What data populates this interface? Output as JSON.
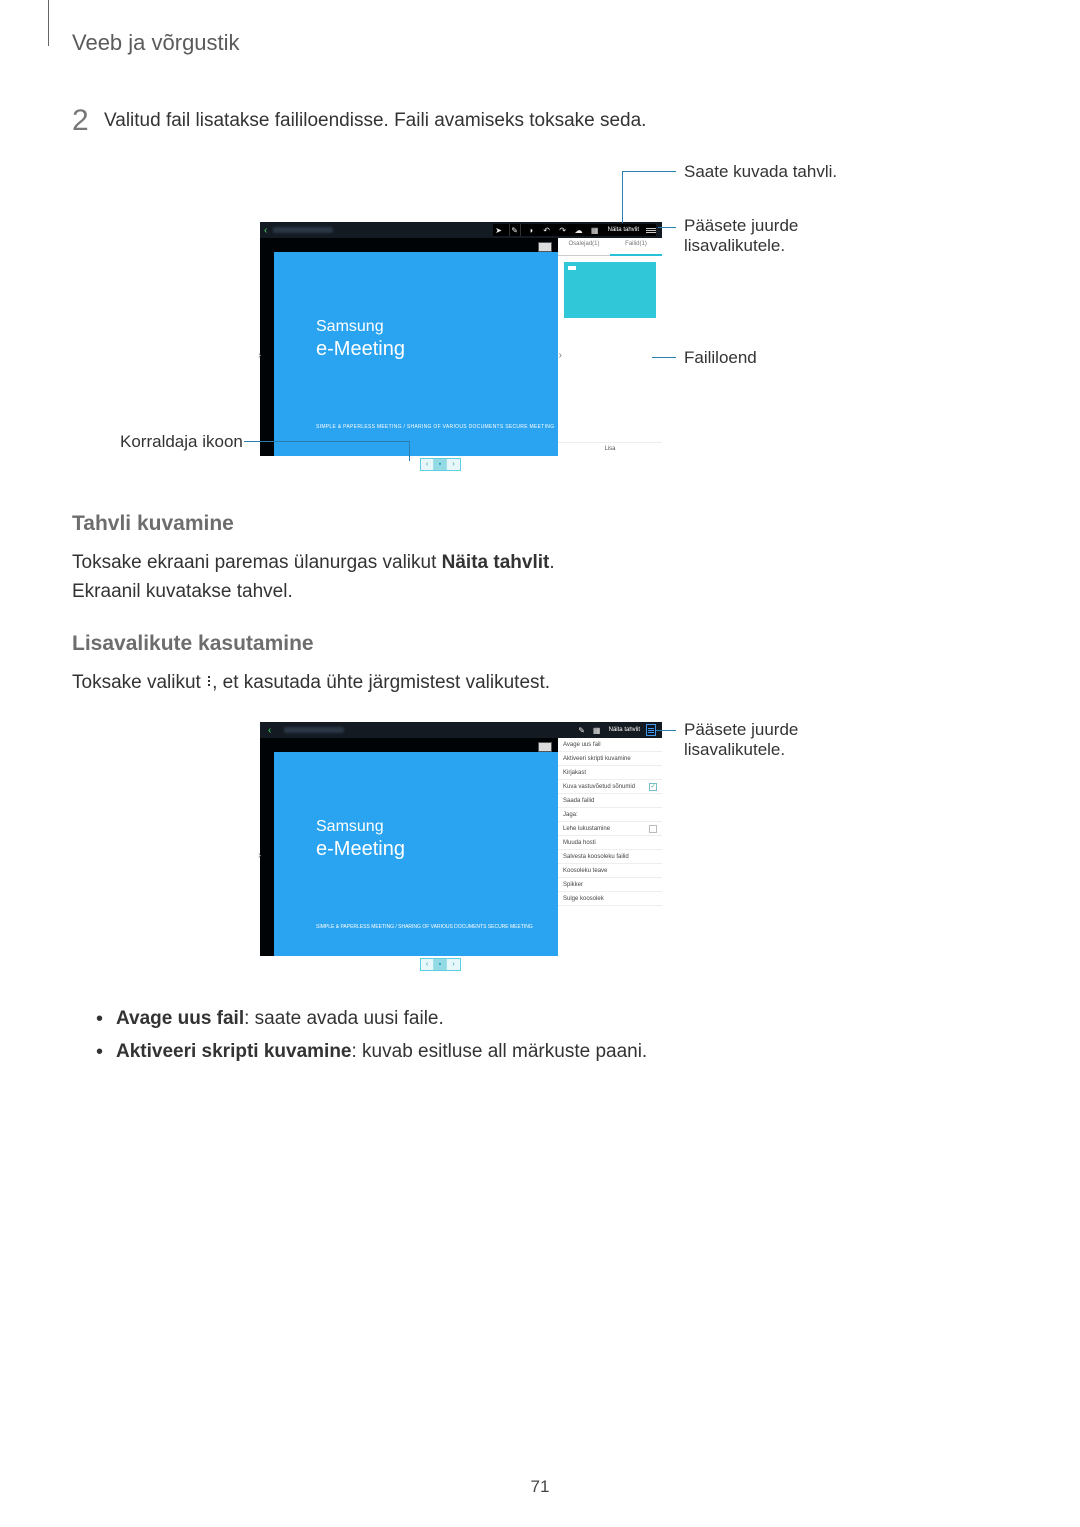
{
  "header": {
    "label": "Veeb ja võrgustik"
  },
  "step": {
    "number": "2",
    "text": "Valitud fail lisatakse faililoendisse. Faili avamiseks toksake seda."
  },
  "fig1": {
    "brand": "Samsung",
    "product": "e-Meeting",
    "caption": "SIMPLE & PAPERLESS MEETING / SHARING OF VARIOUS DOCUMENTS SECURE MEETING",
    "naita": "Näita tahvlit",
    "tab_participants": "Osalejad(1)",
    "tab_files": "Failid(1)",
    "add_button": "Lisa",
    "callouts": {
      "show_whiteboard": "Saate kuvada tahvli.",
      "more_options": "Pääsete juurde lisavalikutele.",
      "file_list": "Faililoend",
      "host_icon": "Korraldaja ikoon"
    }
  },
  "section_whiteboard": {
    "heading": "Tahvli kuvamine",
    "p1_before": "Toksake ekraani paremas ülanurgas valikut ",
    "p1_bold": "Näita tahvlit",
    "p1_after": ".",
    "p2": "Ekraanil kuvatakse tahvel."
  },
  "section_options": {
    "heading": "Lisavalikute kasutamine",
    "p_before": "Toksake valikut ",
    "p_after": ", et kasutada ühte järgmistest valikutest."
  },
  "fig2": {
    "brand": "Samsung",
    "product": "e-Meeting",
    "caption": "SIMPLE & PAPERLESS MEETING / SHARING OF VARIOUS DOCUMENTS SECURE MEETING",
    "naita": "Näita tahvlit",
    "menu": {
      "open_new": "Avage uus fail",
      "activate_script": "Aktiveeri skripti kuvamine",
      "mailbox": "Kirjakast",
      "show_received": "Kuva vastuvõetud sõnumid",
      "send_files": "Saada failid",
      "share": "Jaga:",
      "lock_page": "Lehe lukustamine",
      "change_host": "Muuda hosti",
      "save_meeting": "Salvesta koosoleku failid",
      "meeting_info": "Koosoleku teave",
      "help": "Spikker",
      "close_meeting": "Sulge koosolek"
    },
    "callout_more": "Pääsete juurde lisavalikutele."
  },
  "bullets": {
    "b1_bold": "Avage uus fail",
    "b1_rest": ": saate avada uusi faile.",
    "b2_bold": "Aktiveeri skripti kuvamine",
    "b2_rest": ": kuvab esitluse all märkuste paani."
  },
  "page_number": "71"
}
